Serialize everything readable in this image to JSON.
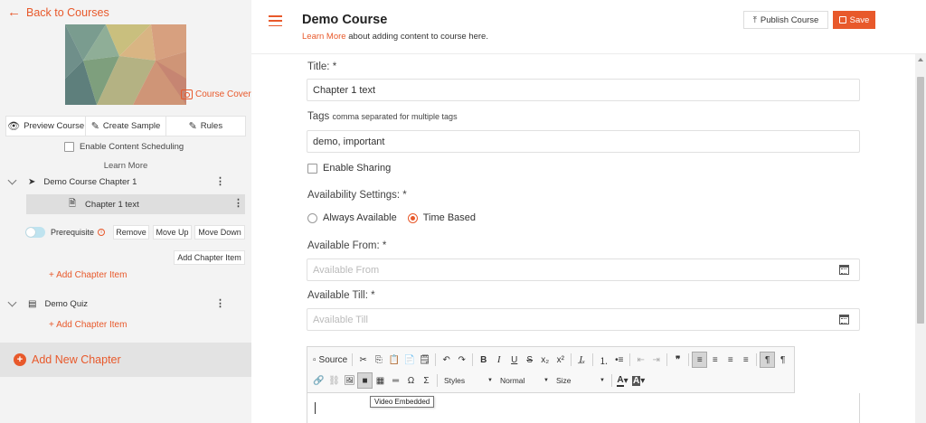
{
  "sidebar": {
    "back_label": "Back to Courses",
    "cover_label": "Course Cover",
    "buttons": {
      "preview": "Preview Course",
      "sample": "Create Sample",
      "rules": "Rules"
    },
    "scheduling_label": "Enable Content Scheduling",
    "learn_more": "Learn More",
    "chapters": [
      {
        "title": "Demo Course Chapter 1",
        "items": [
          {
            "title": "Chapter 1 text"
          }
        ],
        "prerequisite_label": "Prerequisite",
        "actions": {
          "remove": "Remove",
          "move_up": "Move Up",
          "move_down": "Move Down",
          "add_chapter_item": "Add Chapter Item"
        },
        "add_item_label": "+ Add Chapter Item"
      },
      {
        "title": "Demo Quiz",
        "add_item_label": "+ Add Chapter Item"
      }
    ],
    "add_new_chapter": "Add New Chapter"
  },
  "header": {
    "title": "Demo Course",
    "subtitle_link": "Learn More",
    "subtitle_rest": " about adding content to course here.",
    "publish_label": "Publish Course",
    "save_label": "Save"
  },
  "form": {
    "title_label": "Title: *",
    "title_value": "Chapter 1 text",
    "tags_label": "Tags",
    "tags_hint": "comma separated for multiple tags",
    "tags_value": "demo, important",
    "sharing_label": "Enable Sharing",
    "availability_label": "Availability Settings: *",
    "availability_options": [
      "Always Available",
      "Time Based"
    ],
    "availability_selected": "Time Based",
    "from_label": "Available From: *",
    "from_placeholder": "Available From",
    "till_label": "Available Till: *",
    "till_placeholder": "Available Till"
  },
  "editor": {
    "source_label": "Source",
    "styles_label": "Styles",
    "format_label": "Normal",
    "size_label": "Size",
    "tooltip": "Video Embedded"
  },
  "colors": {
    "accent": "#e8592b",
    "sidebar_bg": "#f3f3f3",
    "selected_item_bg": "#dedede"
  }
}
